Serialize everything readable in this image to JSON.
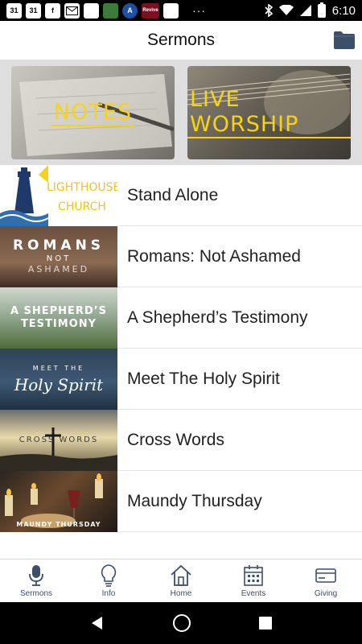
{
  "status_bar": {
    "time": "6:10",
    "icons": [
      "31",
      "31",
      "f",
      "mail",
      "",
      "sg",
      "A",
      "Revive",
      ""
    ],
    "more": "···"
  },
  "header": {
    "title": "Sermons"
  },
  "banner": {
    "notes_label": "Notes",
    "worship_label": "Live Worship"
  },
  "sermons": [
    {
      "title": "Stand Alone",
      "thumb_line1": "LIGHTHOUSE",
      "thumb_line2": "CHURCH"
    },
    {
      "title": "Romans: Not Ashamed",
      "thumb_line1": "ROMANS",
      "thumb_line2": "NOT",
      "thumb_line3": "ASHAMED"
    },
    {
      "title": "A Shepherd’s Testimony",
      "thumb_line1": "A SHEPHERD’S",
      "thumb_line2": "TESTIMONY"
    },
    {
      "title": "Meet The Holy Spirit",
      "thumb_line1": "MEET THE",
      "thumb_line2": "Holy Spirit"
    },
    {
      "title": "Cross Words",
      "thumb_line1": "CROSS WORDS"
    },
    {
      "title": "Maundy Thursday",
      "thumb_line1": "MAUNDY THURSDAY"
    }
  ],
  "bottom_nav": [
    {
      "label": "Sermons",
      "icon": "microphone-icon"
    },
    {
      "label": "Info",
      "icon": "lightbulb-icon"
    },
    {
      "label": "Home",
      "icon": "home-icon"
    },
    {
      "label": "Events",
      "icon": "calendar-icon"
    },
    {
      "label": "Giving",
      "icon": "credit-card-icon"
    }
  ],
  "colors": {
    "accent_navy": "#3b4f6b",
    "banner_yellow": "#f7d21b"
  }
}
